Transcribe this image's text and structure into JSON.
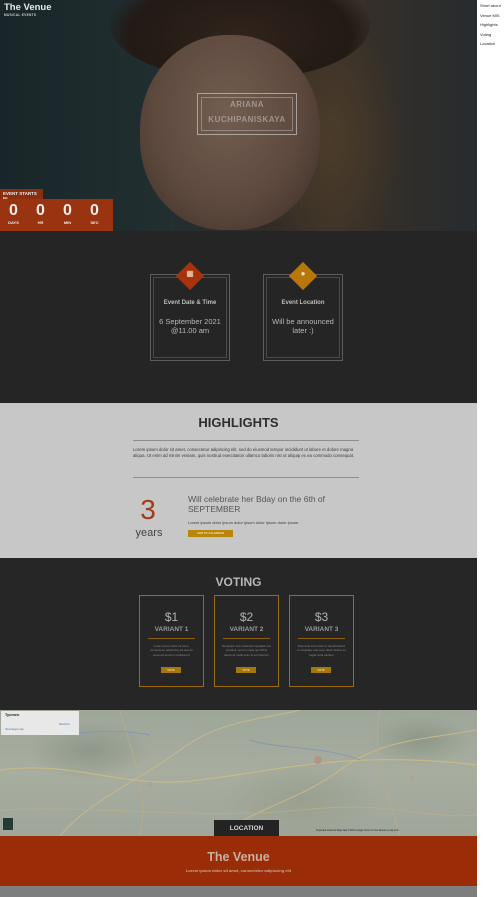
{
  "brand": {
    "title": "The Venue",
    "subtitle": "MUSICAL EVENTS"
  },
  "side_menu": {
    "items": [
      "Short about",
      "Venue MIS",
      "Highlights",
      "Voting",
      "Location"
    ]
  },
  "hero": {
    "name_line1": "ARIANA",
    "name_line2": "KUCHIPANISKAYA",
    "countdown_label": "EVENT STARTS IN",
    "countdown": [
      {
        "value": "0",
        "unit": "DAYS"
      },
      {
        "value": "0",
        "unit": "HR"
      },
      {
        "value": "0",
        "unit": "MIN"
      },
      {
        "value": "0",
        "unit": "SEC"
      }
    ]
  },
  "event": {
    "date_card": {
      "title": "Event Date & Time",
      "value": "6 September 2021 @11.00 am",
      "icon": "calendar-icon",
      "color": "#a7320b"
    },
    "location_card": {
      "title": "Event Location",
      "value": "Will be announced later :)",
      "icon": "map-pin-icon",
      "color": "#b8770b"
    }
  },
  "highlights": {
    "title": "HIGHLIGHTS",
    "lorem": "Lorem ipsum dolor sit amet, consectetur adipiscing elit, sed do eiusmod tempor incididunt ut labore et dolore magna aliqua. Ut enim ad minim veniam, quis nostrud exercitation ullamco laboris nisi ut aliquip ex ea commodo consequat.",
    "number": "3",
    "number_unit": "years",
    "celebrate": "Will celebrate her Bday on the 6th of SEPTEMBER",
    "small_text": "Lorem ipsum dolor ipsum dolor ipsum dolor ipsum dolor ipsum",
    "button": "ADD TO CALENDAR"
  },
  "voting": {
    "title": "VOTING",
    "cards": [
      {
        "price": "$1",
        "variant": "VARIANT 1",
        "text": "Lorem ipsum dolor sit amet, consectetur adipiscing elit sed do eiusmod tempor incididunt ut",
        "button": "VOTE"
      },
      {
        "price": "$2",
        "variant": "VARIANT 2",
        "text": "Excepteur sint occaecat cupidatat non proident, sunt in culpa qui officia deserunt mollit anim id est laborum",
        "button": "VOTE"
      },
      {
        "price": "$3",
        "variant": "VARIANT 3",
        "text": "Duis aute irure dolor in reprehenderit in voluptate velit esse cillum dolore eu fugiat nulla pariatur",
        "button": "VOTE"
      }
    ]
  },
  "map": {
    "box_title": "Tyumen",
    "box_link": "View larger map",
    "box_dir": "Directions",
    "attribution": "Keyboard shortcuts   Map data ©2021 Google   Terms of Use   Report a map error",
    "button": "LOCATION"
  },
  "footer": {
    "title": "The Venue",
    "subtitle": "Lorem ipsum dolor sit amet, consectetur adipiscing elit"
  }
}
